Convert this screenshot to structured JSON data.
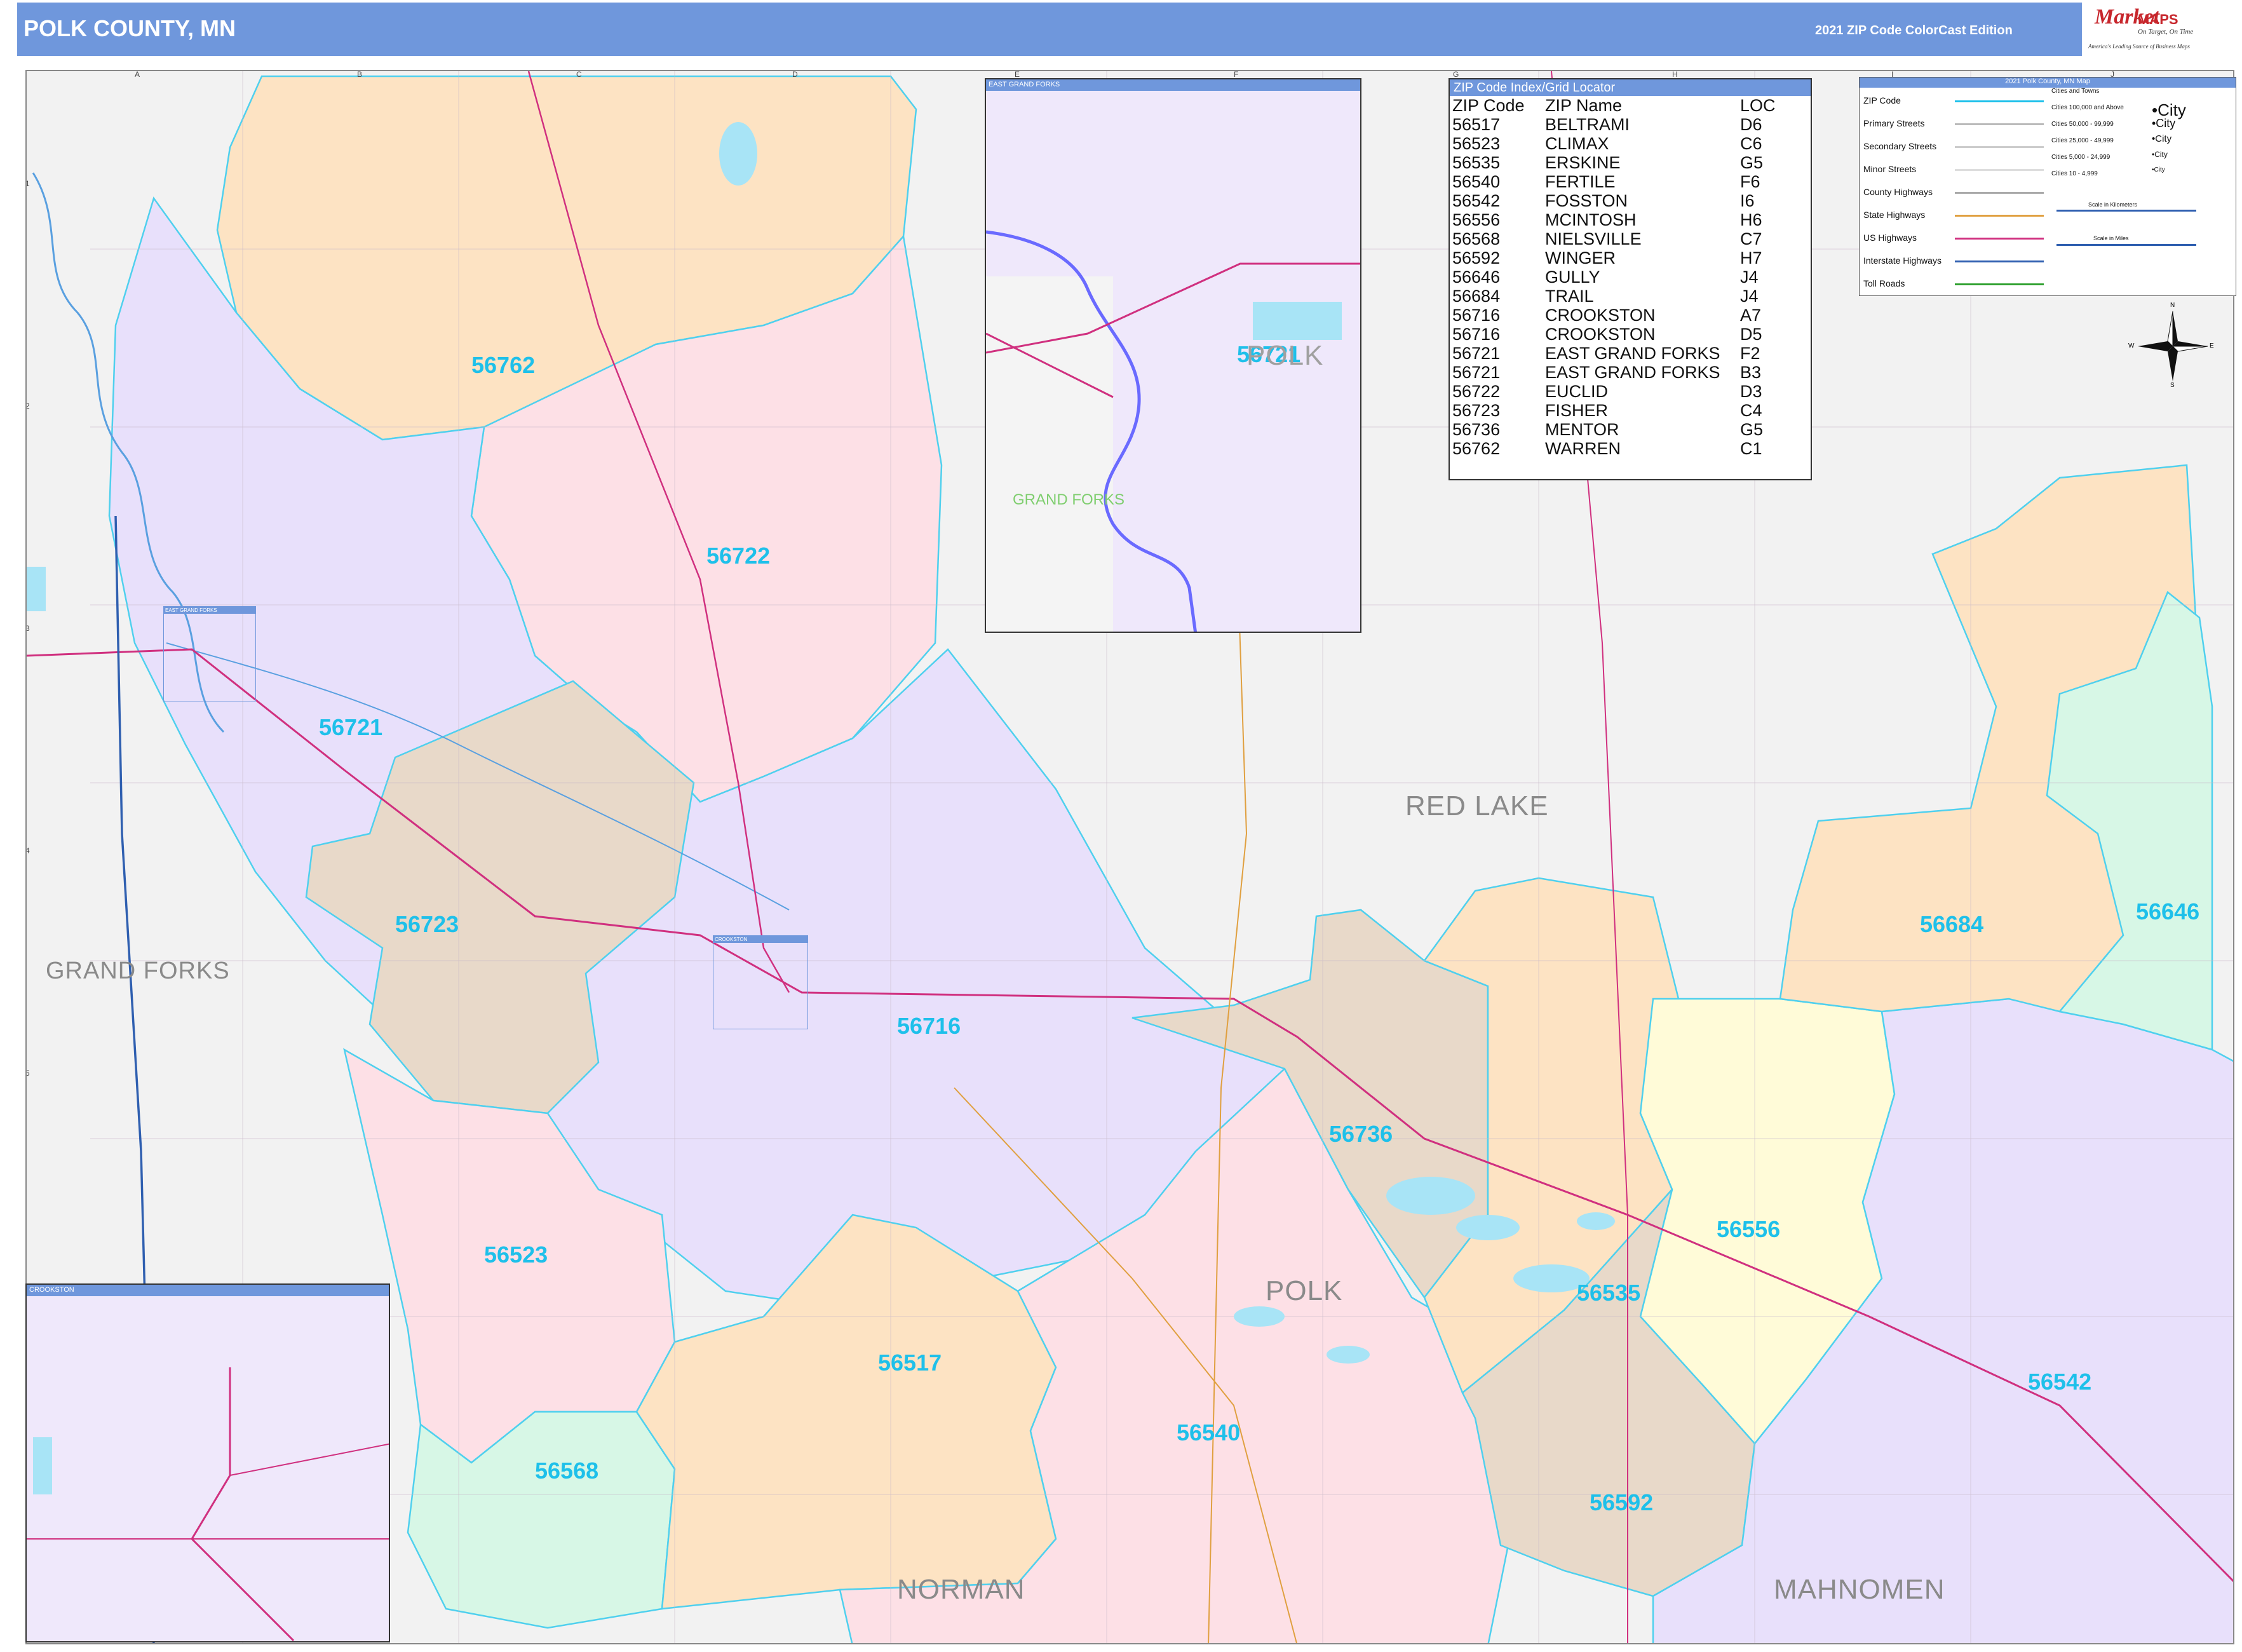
{
  "header": {
    "title": "POLK COUNTY, MN",
    "edition": "2021 ZIP Code ColorCast Edition"
  },
  "logo": {
    "mark": "Market",
    "sub": "MAPS",
    "tagline": "On Target, On Time",
    "tagline2": "America's Leading Source of Business Maps"
  },
  "grid": {
    "columns": [
      "A",
      "B",
      "C",
      "D",
      "E",
      "F",
      "G",
      "H",
      "I",
      "J"
    ],
    "rows": [
      "1",
      "2",
      "3",
      "4",
      "5",
      "6",
      "7"
    ]
  },
  "index": {
    "title": "ZIP Code Index/Grid Locator",
    "headers": [
      "ZIP Code",
      "ZIP Name",
      "LOC"
    ],
    "rows": [
      [
        "56517",
        "BELTRAMI",
        "D6"
      ],
      [
        "56523",
        "CLIMAX",
        "C6"
      ],
      [
        "56535",
        "ERSKINE",
        "G5"
      ],
      [
        "56540",
        "FERTILE",
        "F6"
      ],
      [
        "56542",
        "FOSSTON",
        "I6"
      ],
      [
        "56556",
        "MCINTOSH",
        "H6"
      ],
      [
        "56568",
        "NIELSVILLE",
        "C7"
      ],
      [
        "56592",
        "WINGER",
        "H7"
      ],
      [
        "56646",
        "GULLY",
        "J4"
      ],
      [
        "56684",
        "TRAIL",
        "J4"
      ],
      [
        "56716",
        "CROOKSTON",
        "A7"
      ],
      [
        "56716",
        "CROOKSTON",
        "D5"
      ],
      [
        "56721",
        "EAST GRAND FORKS",
        "F2"
      ],
      [
        "56721",
        "EAST GRAND FORKS",
        "B3"
      ],
      [
        "56722",
        "EUCLID",
        "D3"
      ],
      [
        "56723",
        "FISHER",
        "C4"
      ],
      [
        "56736",
        "MENTOR",
        "G5"
      ],
      [
        "56762",
        "WARREN",
        "C1"
      ]
    ]
  },
  "legend": {
    "title": "2021 Polk County, MN Map",
    "items": [
      {
        "label": "ZIP Code",
        "color": "#1ec0ea"
      },
      {
        "label": "Primary Streets",
        "color": "#bbbbbb"
      },
      {
        "label": "Secondary Streets",
        "color": "#cccccc"
      },
      {
        "label": "Minor Streets",
        "color": "#dddddd"
      },
      {
        "label": "County Highways",
        "color": "#aaaaaa"
      },
      {
        "label": "State Highways",
        "color": "#e0a040"
      },
      {
        "label": "US Highways",
        "color": "#d0307f"
      },
      {
        "label": "Interstate Highways",
        "color": "#2f5fb0"
      },
      {
        "label": "Toll Roads",
        "color": "#2fa02f"
      }
    ],
    "city_header": "Cities and Towns",
    "cities": [
      {
        "range": "Cities 100,000 and Above",
        "sample": "City"
      },
      {
        "range": "Cities 50,000 - 99,999",
        "sample": "City"
      },
      {
        "range": "Cities 25,000 - 49,999",
        "sample": "City"
      },
      {
        "range": "Cities 5,000 - 24,999",
        "sample": "City"
      },
      {
        "range": "Cities 10 - 4,999",
        "sample": "City"
      }
    ],
    "scale_km": "Scale in Kilometers",
    "scale_mi": "Scale in Miles",
    "compass": {
      "n": "N",
      "s": "S",
      "e": "E",
      "w": "W"
    }
  },
  "zips": [
    {
      "code": "56762",
      "color": "#fde3c3"
    },
    {
      "code": "56722",
      "color": "#fde0e6"
    },
    {
      "code": "56721",
      "color": "#e8e0fb"
    },
    {
      "code": "56723",
      "color": "#e8d9c9"
    },
    {
      "code": "56716",
      "color": "#e8e0fb"
    },
    {
      "code": "56523",
      "color": "#fde0e6"
    },
    {
      "code": "56568",
      "color": "#d7f7e6"
    },
    {
      "code": "56517",
      "color": "#fde3c3"
    },
    {
      "code": "56540",
      "color": "#fde0e6"
    },
    {
      "code": "56736",
      "color": "#e8d9c9"
    },
    {
      "code": "56535",
      "color": "#fde3c3"
    },
    {
      "code": "56556",
      "color": "#fffbd8"
    },
    {
      "code": "56592",
      "color": "#e8d9c9"
    },
    {
      "code": "56542",
      "color": "#e8e0fb"
    },
    {
      "code": "56684",
      "color": "#fde3c3"
    },
    {
      "code": "56646",
      "color": "#d7f7e6"
    }
  ],
  "counties": {
    "red_lake": "RED LAKE",
    "grand_forks": "GRAND FORKS",
    "polk": "POLK",
    "norman": "NORMAN",
    "mahnomen": "MAHNOMEN"
  },
  "insets": {
    "egf": {
      "title": "EAST GRAND FORKS",
      "zip": "56721",
      "county_a": "POLK",
      "county_b": "GRAND FORKS"
    },
    "crookston": {
      "title": "CROOKSTON"
    }
  },
  "small_boxes": {
    "egf": "EAST GRAND FORKS",
    "crookston": "CROOKSTON"
  }
}
